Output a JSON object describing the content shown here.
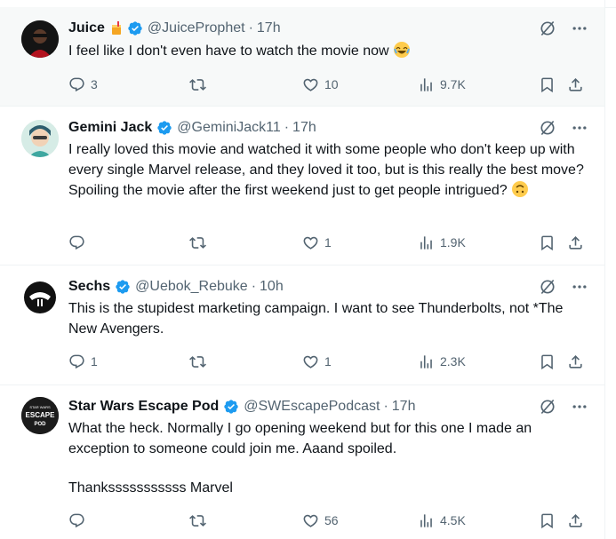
{
  "tweets": [
    {
      "name": "Juice",
      "handle": "@JuiceProphet",
      "time": "17h",
      "text": [
        "I feel like I don't even have to watch the movie now"
      ],
      "replies": "3",
      "reposts": "",
      "likes": "10",
      "views": "9.7K"
    },
    {
      "name": "Gemini Jack",
      "handle": "@GeminiJack11",
      "time": "17h",
      "text": [
        "I really loved this movie and watched it with some people who don't keep up with every single Marvel release, and they loved it too, but is this really the best move? Spoiling the movie after the first weekend just to get people intrigued?"
      ],
      "replies": "",
      "reposts": "",
      "likes": "1",
      "views": "1.9K"
    },
    {
      "name": "Sechs",
      "handle": "@Uebok_Rebuke",
      "time": "10h",
      "text": [
        "This is the stupidest marketing campaign. I want to see Thunderbolts, not *The New Avengers."
      ],
      "replies": "1",
      "reposts": "",
      "likes": "1",
      "views": "2.3K"
    },
    {
      "name": "Star Wars Escape Pod",
      "handle": "@SWEscapePodcast",
      "time": "17h",
      "text": [
        "What the heck. Normally I go opening weekend but for this one I made an exception to someone could join me. Aaand spoiled.",
        "Thanksssssssssss Marvel"
      ],
      "replies": "",
      "reposts": "",
      "likes": "56",
      "views": "4.5K"
    }
  ],
  "avatar_text": {
    "sw_line1": "STAR WARS",
    "sw_line2": "ESCAPE",
    "sw_line3": "POD"
  },
  "colors": {
    "verified": "#1d9bf0",
    "muted": "#536471",
    "border": "#eff3f4",
    "hover_bg": "#f7f9f9"
  },
  "icons": [
    "reply-icon",
    "repost-icon",
    "like-icon",
    "views-icon",
    "bookmark-icon",
    "share-icon",
    "grok-icon",
    "more-icon",
    "verified-badge-icon"
  ]
}
